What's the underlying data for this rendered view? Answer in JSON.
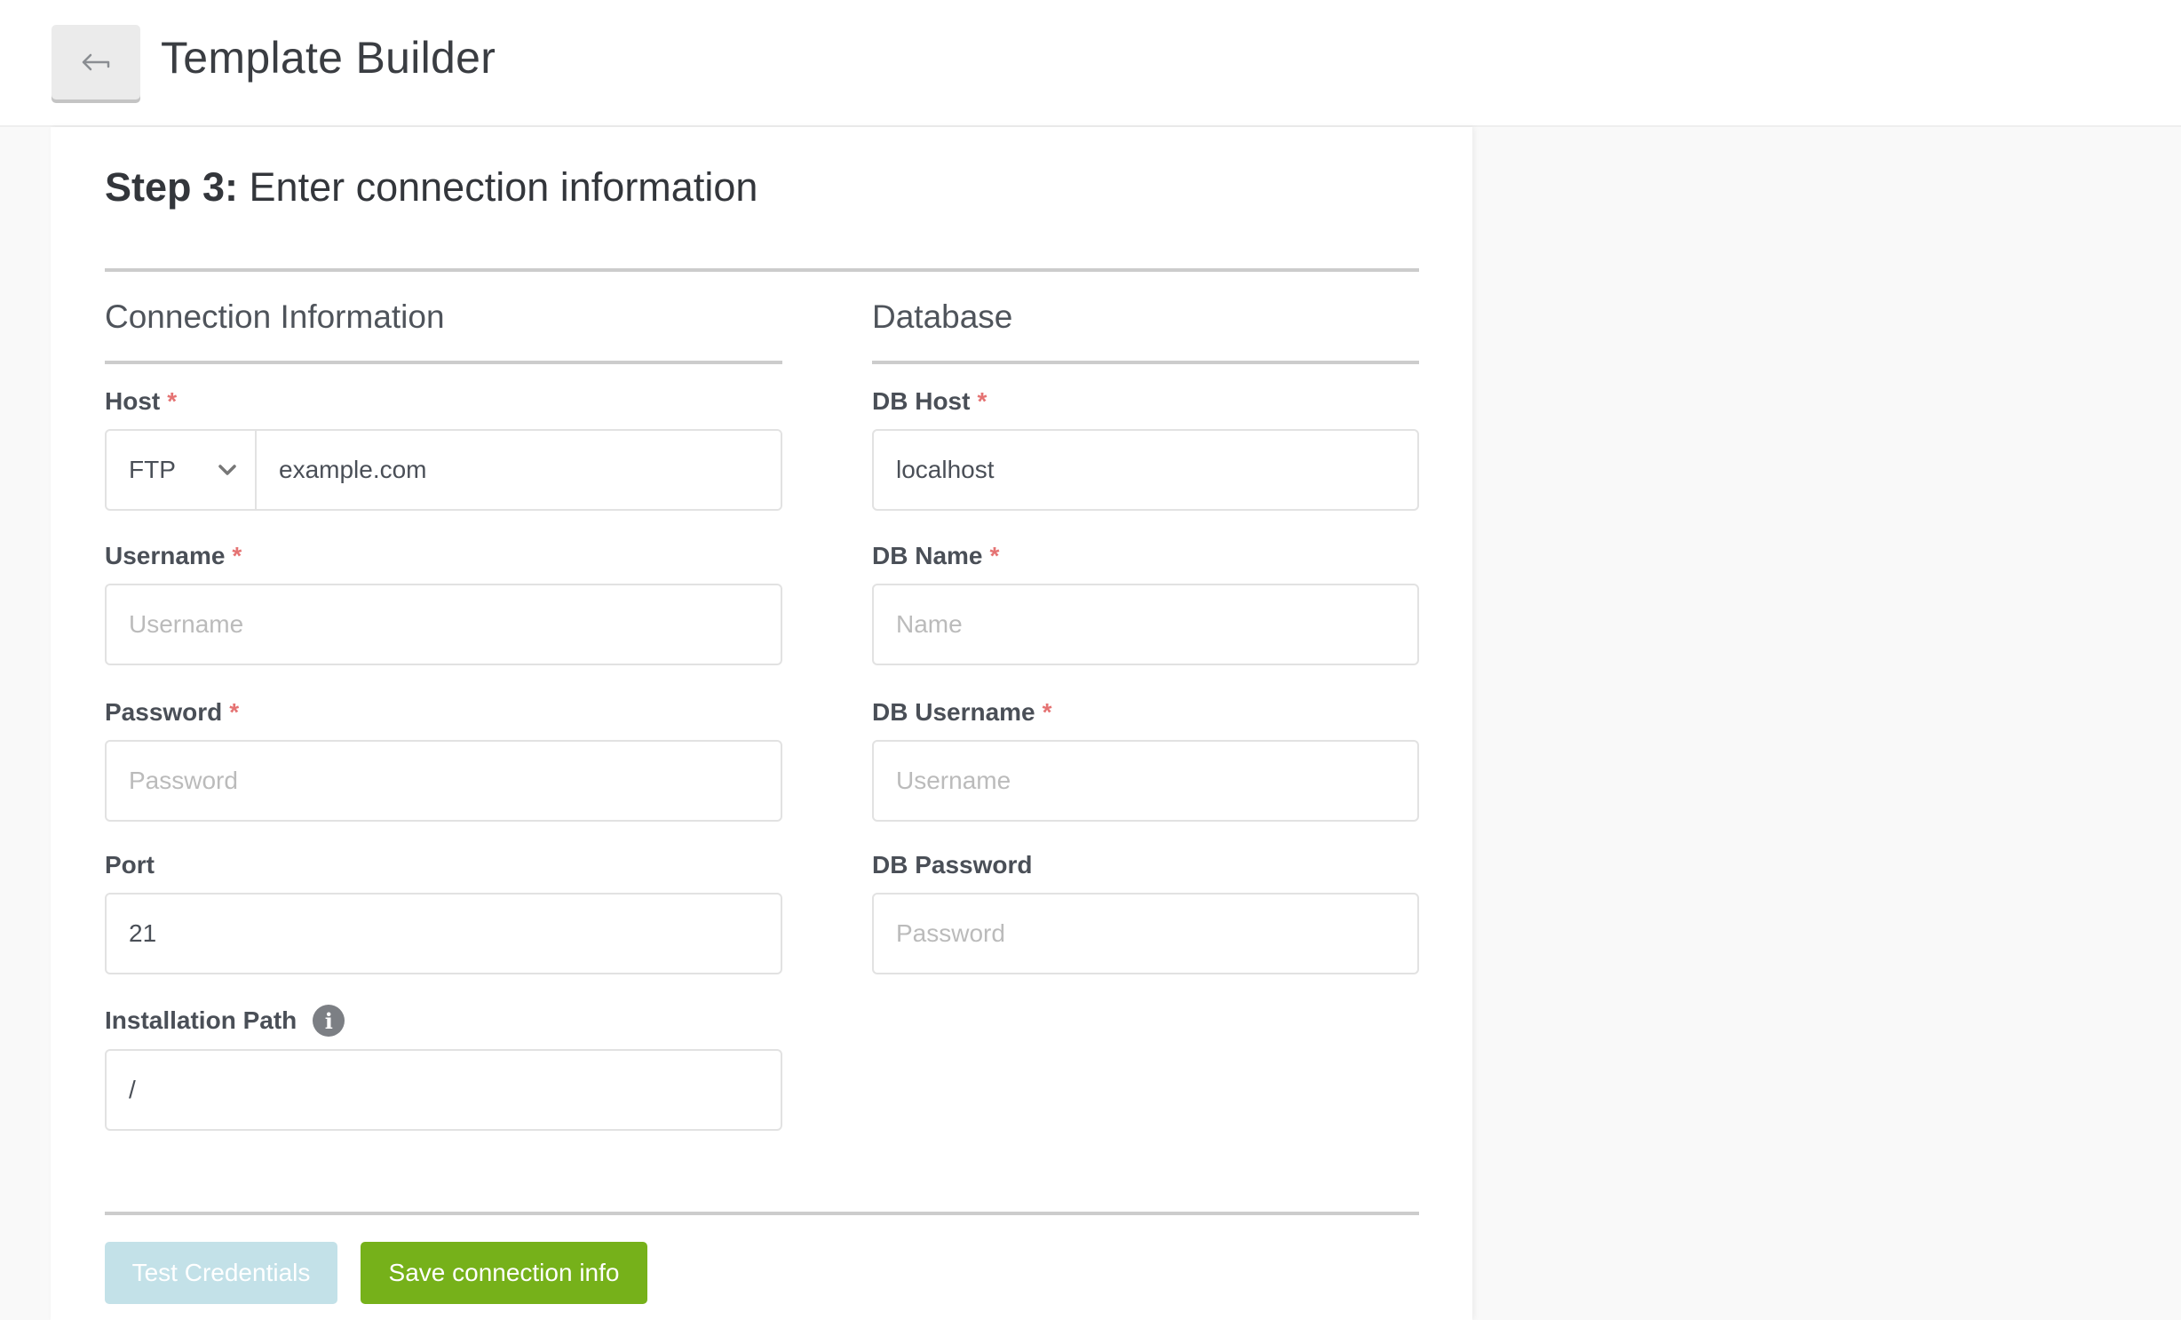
{
  "header": {
    "title": "Template Builder",
    "back_icon": "arrow-left-icon"
  },
  "form": {
    "step_prefix": "Step 3:",
    "step_title": "Enter connection information",
    "connection": {
      "section_title": "Connection Information",
      "host": {
        "label": "Host",
        "required": "*",
        "protocol": "FTP",
        "value": "example.com"
      },
      "username": {
        "label": "Username",
        "required": "*",
        "value": "",
        "placeholder": "Username"
      },
      "password": {
        "label": "Password",
        "required": "*",
        "value": "",
        "placeholder": "Password"
      },
      "port": {
        "label": "Port",
        "value": "21",
        "placeholder": ""
      },
      "install_path": {
        "label": "Installation Path",
        "info_icon": "info-icon",
        "value": "/",
        "placeholder": ""
      }
    },
    "database": {
      "section_title": "Database",
      "db_host": {
        "label": "DB Host",
        "required": "*",
        "value": "localhost",
        "placeholder": ""
      },
      "db_name": {
        "label": "DB Name",
        "required": "*",
        "value": "",
        "placeholder": "Name"
      },
      "db_username": {
        "label": "DB Username",
        "required": "*",
        "value": "",
        "placeholder": "Username"
      },
      "db_password": {
        "label": "DB Password",
        "value": "",
        "placeholder": "Password"
      }
    },
    "buttons": {
      "test": "Test Credentials",
      "save": "Save connection info"
    }
  },
  "colors": {
    "accent_green": "#76b11a",
    "disabled_blue": "#c3e1e8",
    "required_red": "#e57373"
  }
}
